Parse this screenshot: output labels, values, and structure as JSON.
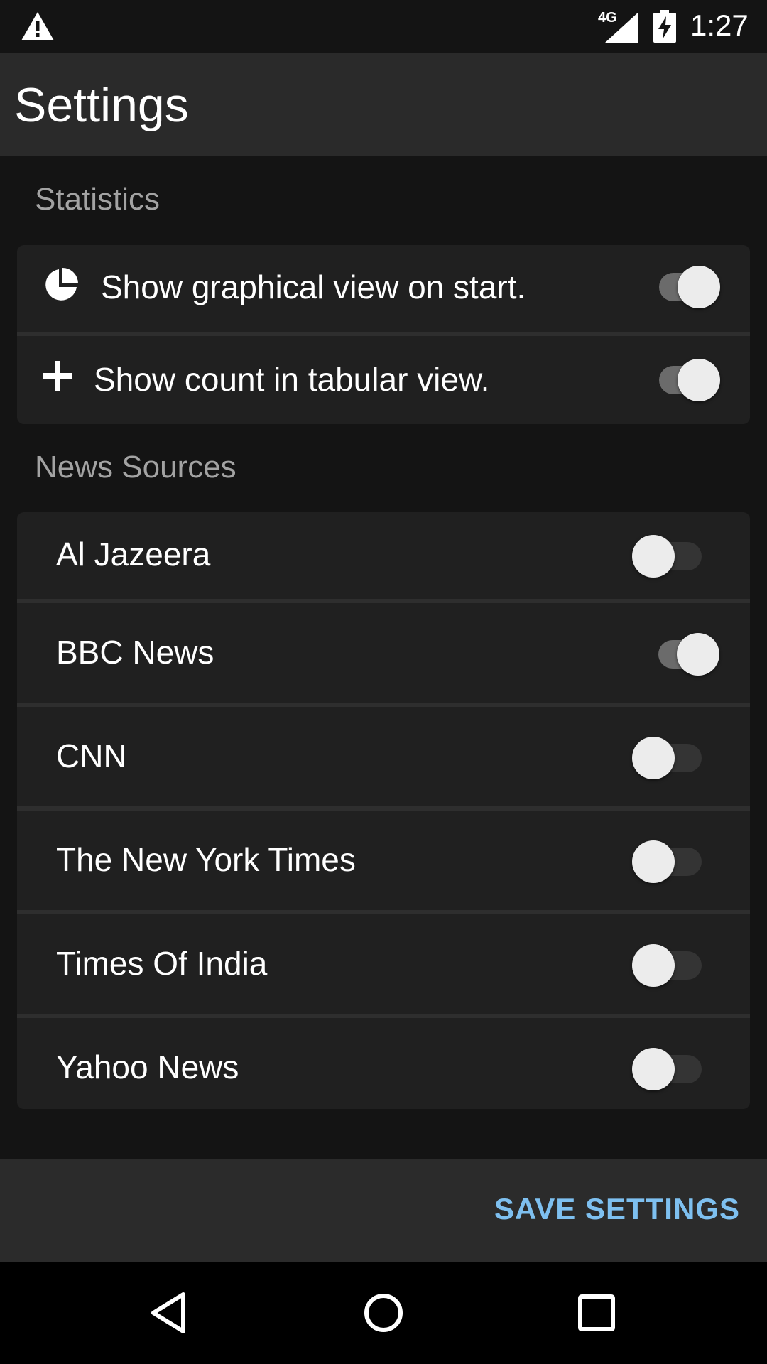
{
  "status_bar": {
    "network_label": "4G",
    "time": "1:27",
    "icons": [
      "warning-icon",
      "signal-icon",
      "battery-charging-icon"
    ]
  },
  "app_bar": {
    "title": "Settings"
  },
  "sections": {
    "statistics": {
      "header": "Statistics",
      "items": [
        {
          "label": "Show graphical view on start.",
          "icon": "pie-chart-icon",
          "enabled": true
        },
        {
          "label": "Show count in tabular view.",
          "icon": "plus-icon",
          "enabled": true
        }
      ]
    },
    "news_sources": {
      "header": "News Sources",
      "items": [
        {
          "label": "Al Jazeera",
          "enabled": false
        },
        {
          "label": "BBC News",
          "enabled": true
        },
        {
          "label": "CNN",
          "enabled": false
        },
        {
          "label": "The New York Times",
          "enabled": false
        },
        {
          "label": "Times Of India",
          "enabled": false
        },
        {
          "label": "Yahoo News",
          "enabled": false
        }
      ]
    }
  },
  "bottom_bar": {
    "save_label": "SAVE SETTINGS"
  },
  "nav_bar": {
    "icons": [
      "back-icon",
      "home-icon",
      "recents-icon"
    ]
  },
  "colors": {
    "accent": "#7ec0f0",
    "background": "#141414",
    "card": "#202020",
    "appbar": "#2a2a2a"
  }
}
